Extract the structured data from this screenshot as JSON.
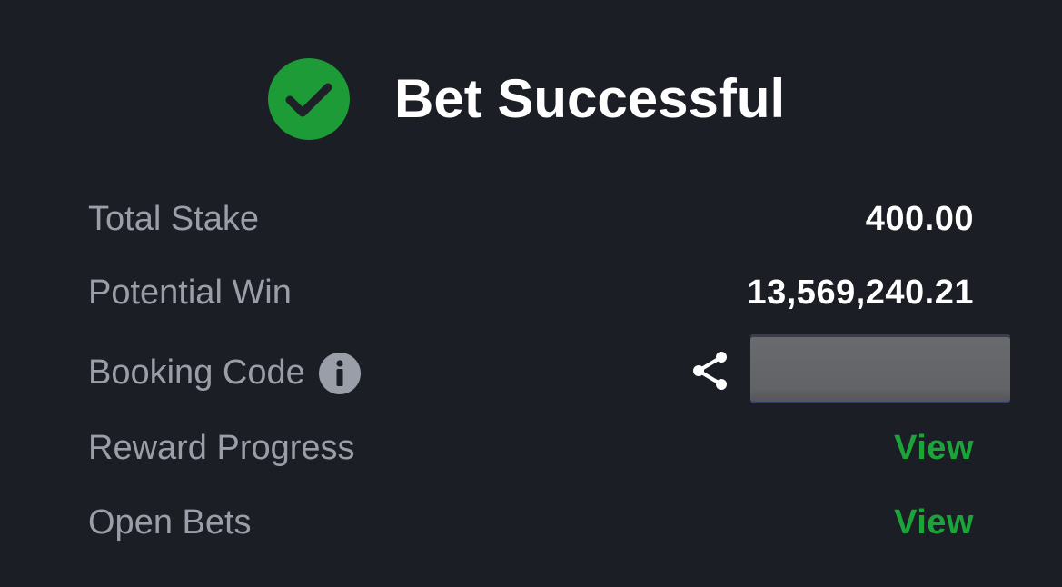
{
  "header": {
    "title": "Bet Successful",
    "icon": "check-circle-icon",
    "icon_color": "#1c9b36"
  },
  "summary": {
    "total_stake": {
      "label": "Total Stake",
      "value": "400.00"
    },
    "potential_win": {
      "label": "Potential Win",
      "value": "13,569,240.21"
    },
    "booking_code": {
      "label": "Booking Code",
      "info_icon": "info-icon",
      "share_icon": "share-icon",
      "code": ""
    },
    "reward_progress": {
      "label": "Reward Progress",
      "link": "View"
    },
    "open_bets": {
      "label": "Open Bets",
      "link": "View"
    }
  },
  "colors": {
    "background": "#1b1e25",
    "label": "#9a9ea8",
    "value": "#ffffff",
    "link": "#1ca33a"
  }
}
